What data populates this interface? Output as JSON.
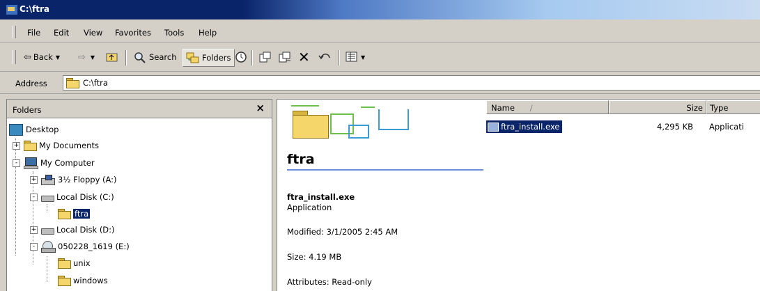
{
  "window": {
    "title": "C:\\ftra"
  },
  "menu": {
    "items": [
      "File",
      "Edit",
      "View",
      "Favorites",
      "Tools",
      "Help"
    ]
  },
  "toolbar": {
    "back_label": "Back",
    "search_label": "Search",
    "folders_label": "Folders"
  },
  "address": {
    "label": "Address",
    "value": "C:\\ftra"
  },
  "folders_pane": {
    "title": "Folders",
    "close_glyph": "×",
    "tree": [
      {
        "label": "Desktop",
        "icon": "desktop-icon"
      },
      {
        "label": "My Documents",
        "icon": "folder-icon",
        "expander": "+"
      },
      {
        "label": "My Computer",
        "icon": "computer-icon",
        "expander": "-"
      },
      {
        "label": "3½ Floppy (A:)",
        "icon": "floppy-icon",
        "expander": "+"
      },
      {
        "label": "Local Disk (C:)",
        "icon": "drive-icon",
        "expander": "-"
      },
      {
        "label": "ftra",
        "icon": "open-folder-icon",
        "selected": true
      },
      {
        "label": "Local Disk (D:)",
        "icon": "drive-icon",
        "expander": "+"
      },
      {
        "label": "050228_1619 (E:)",
        "icon": "cd-icon",
        "expander": "-"
      },
      {
        "label": "unix",
        "icon": "folder-icon"
      },
      {
        "label": "windows",
        "icon": "folder-icon"
      }
    ]
  },
  "details": {
    "folder_title": "ftra",
    "selected_file": "ftra_install.exe",
    "file_type": "Application",
    "modified": "Modified: 3/1/2005 2:45 AM",
    "size": "Size: 4.19 MB",
    "attributes": "Attributes: Read-only"
  },
  "file_list": {
    "columns": {
      "name": "Name",
      "sort_glyph": "/",
      "size": "Size",
      "type": "Type"
    },
    "rows": [
      {
        "name": "ftra_install.exe",
        "size": "4,295 KB",
        "type": "Applicati"
      }
    ]
  },
  "colors": {
    "selection": "#0a246a",
    "chrome": "#d4d0c8",
    "title_rule": "#6b8fd8"
  }
}
